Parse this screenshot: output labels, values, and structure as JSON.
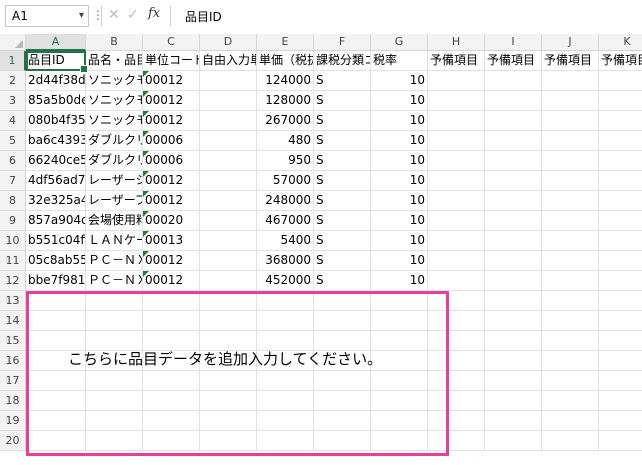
{
  "formula_bar": {
    "name_box": "A1",
    "fx_label": "fx",
    "content": "品目ID"
  },
  "columns": [
    "A",
    "B",
    "C",
    "D",
    "E",
    "F",
    "G",
    "H",
    "I",
    "J",
    "K"
  ],
  "rows": [
    "1",
    "2",
    "3",
    "4",
    "5",
    "6",
    "7",
    "8",
    "9",
    "10",
    "11",
    "12",
    "13",
    "14",
    "15",
    "16",
    "17",
    "18",
    "19",
    "20"
  ],
  "headers": [
    "品目ID",
    "品名・品目",
    "単位コード",
    "自由入力単位",
    "単価（税抜）",
    "課税分類コード",
    "税率",
    "予備項目",
    "予備項目",
    "予備項目",
    "予備項目"
  ],
  "data_rows": [
    [
      "2d44f38da",
      "ソニックモ",
      "00012",
      "",
      "124000",
      "S",
      "10"
    ],
    [
      "85a5b0del",
      "ソニックモ",
      "00012",
      "",
      "128000",
      "S",
      "10"
    ],
    [
      "080b4f354",
      "ソニックモ",
      "00012",
      "",
      "267000",
      "S",
      "10"
    ],
    [
      "ba6c4393b",
      "ダブルクリ",
      "00006",
      "",
      "480",
      "S",
      "10"
    ],
    [
      "66240ce5f",
      "ダブルクリ",
      "00006",
      "",
      "950",
      "S",
      "10"
    ],
    [
      "4df56ad71",
      "レーザーシ",
      "00012",
      "",
      "57000",
      "S",
      "10"
    ],
    [
      "32e325a46",
      "レーザープ",
      "00012",
      "",
      "248000",
      "S",
      "10"
    ],
    [
      "857a904d9",
      "会場使用料",
      "00020",
      "",
      "467000",
      "S",
      "10"
    ],
    [
      "b551c04ff",
      "ＬＡＮケー",
      "00013",
      "",
      "5400",
      "S",
      "10"
    ],
    [
      "05c8ab55b",
      "ＰＣ－ＮＸ",
      "00012",
      "",
      "368000",
      "S",
      "10"
    ],
    [
      "bbe7f9812",
      "ＰＣ－ＮＸ",
      "00012",
      "",
      "452000",
      "S",
      "10"
    ]
  ],
  "note": "こちらに品目データを追加入力してください。",
  "colors": {
    "accent": "#217346",
    "highlight_box": "#e8409a",
    "error_triangle": "#1e7d33"
  }
}
